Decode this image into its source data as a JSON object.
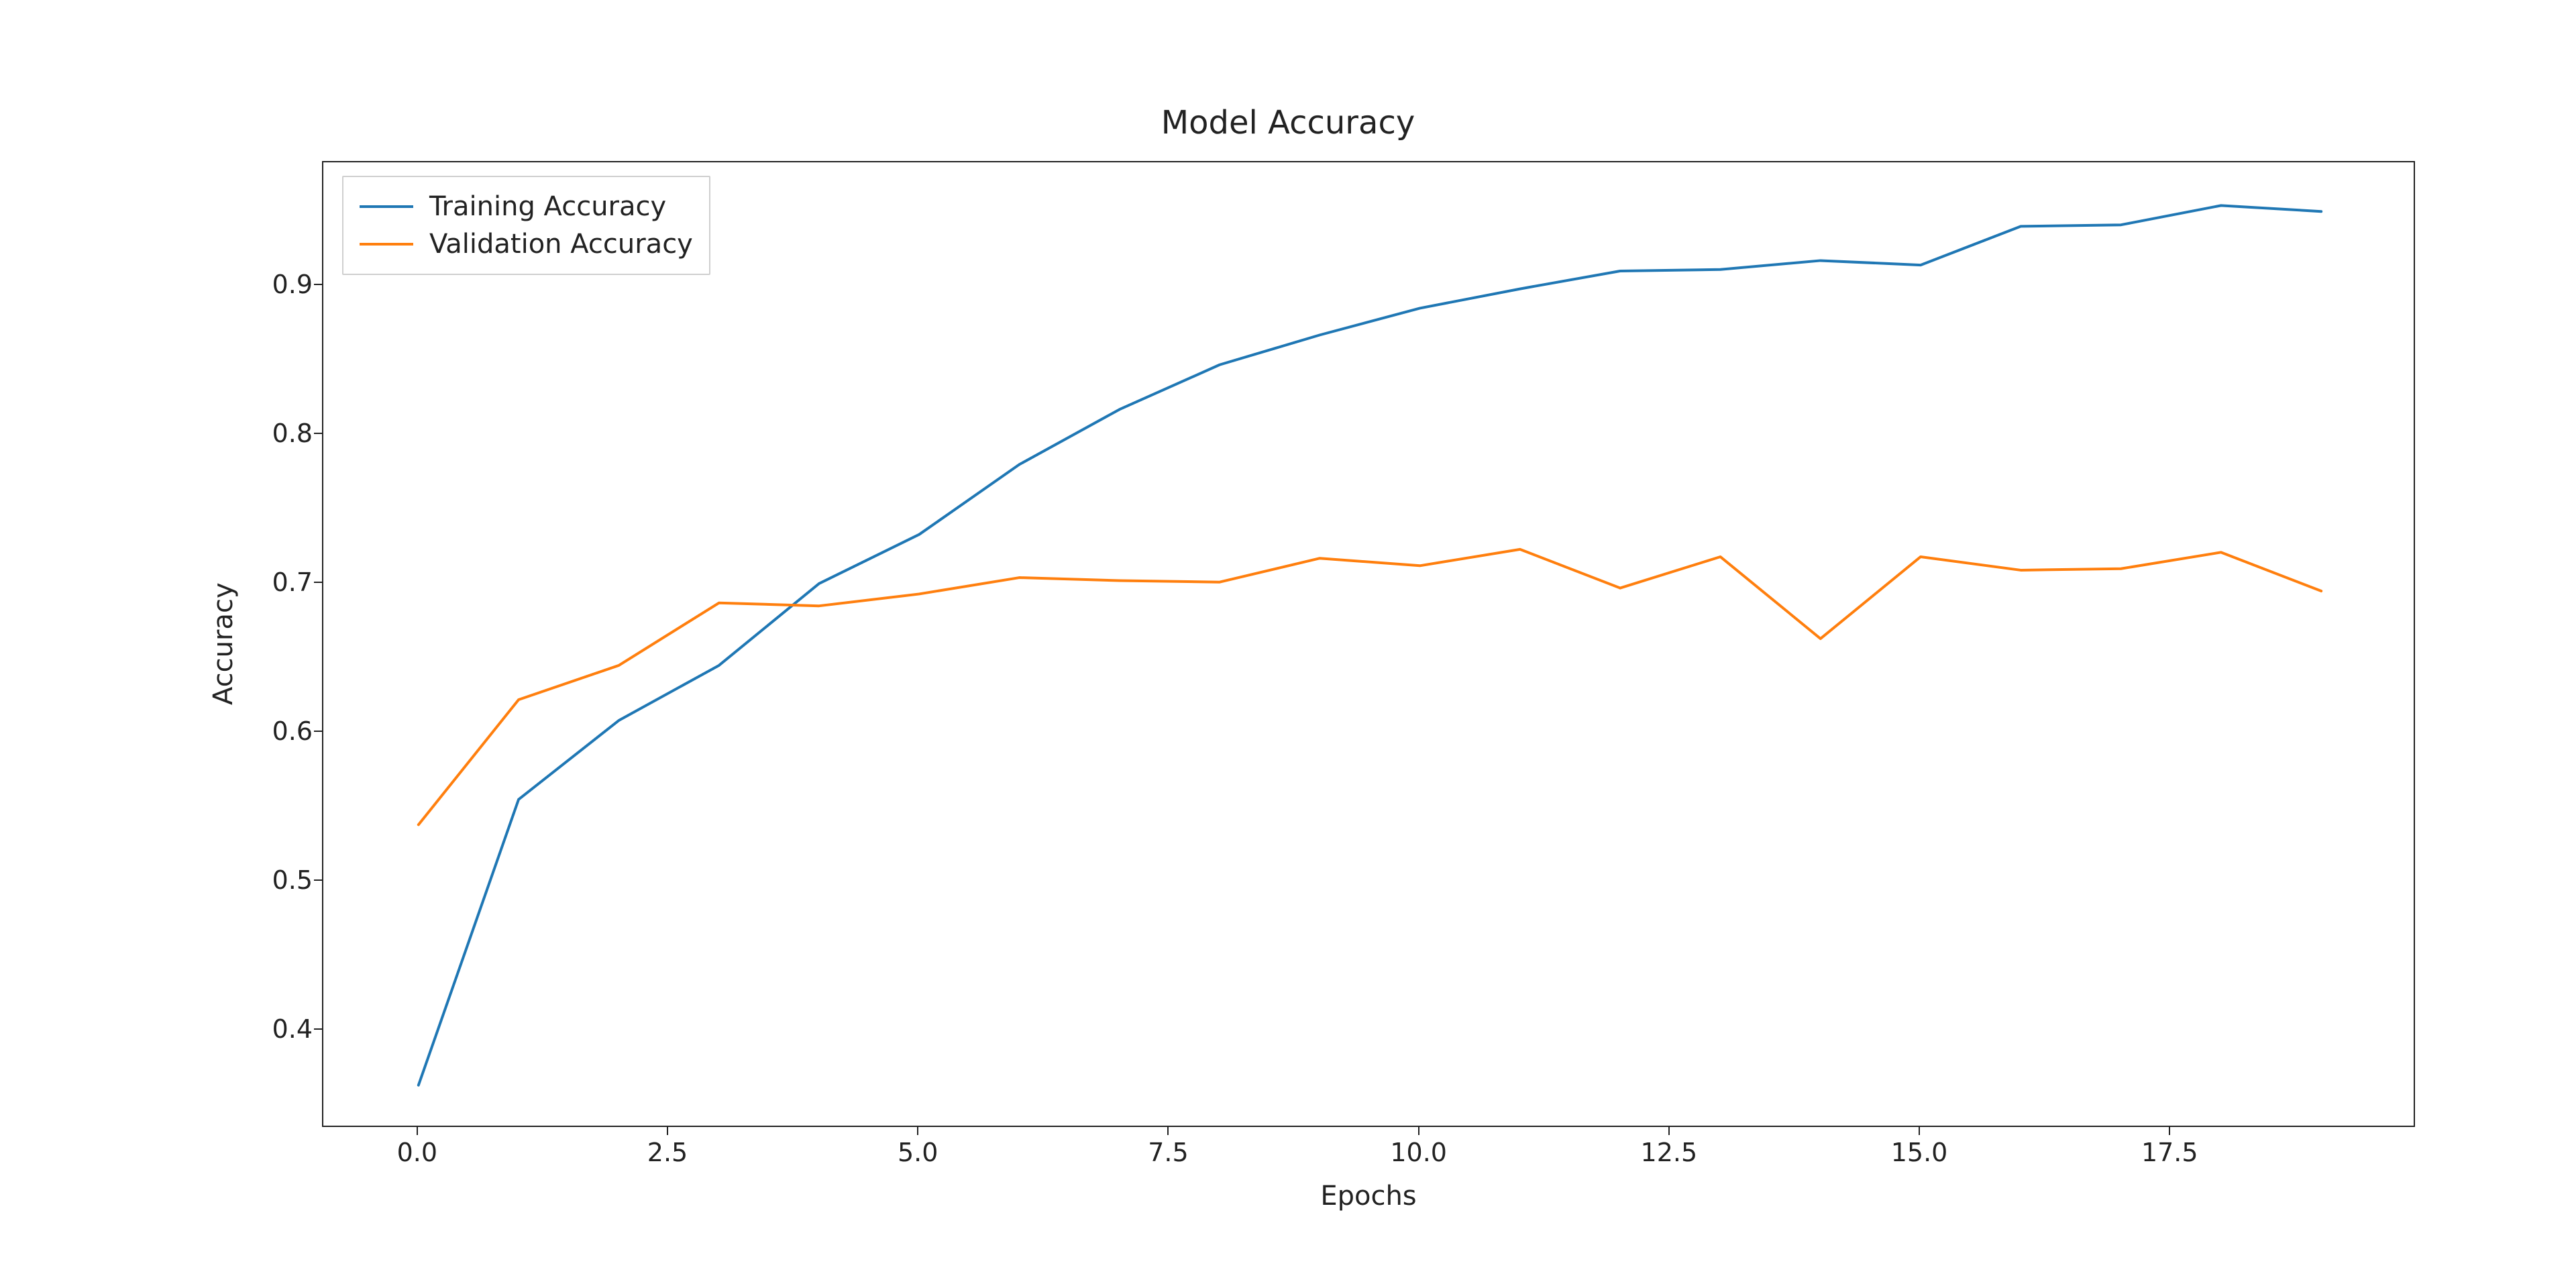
{
  "chart_data": {
    "type": "line",
    "title": "Model Accuracy",
    "xlabel": "Epochs",
    "ylabel": "Accuracy",
    "xlim": [
      -0.95,
      19.95
    ],
    "ylim": [
      0.334,
      0.983
    ],
    "xticks": [
      0.0,
      2.5,
      5.0,
      7.5,
      10.0,
      12.5,
      15.0,
      17.5
    ],
    "yticks": [
      0.4,
      0.5,
      0.6,
      0.7,
      0.8,
      0.9
    ],
    "x": [
      0,
      1,
      2,
      3,
      4,
      5,
      6,
      7,
      8,
      9,
      10,
      11,
      12,
      13,
      14,
      15,
      16,
      17,
      18,
      19
    ],
    "series": [
      {
        "name": "Training Accuracy",
        "color": "#1f77b4",
        "values": [
          0.363,
          0.555,
          0.608,
          0.645,
          0.7,
          0.733,
          0.78,
          0.817,
          0.847,
          0.867,
          0.885,
          0.898,
          0.91,
          0.911,
          0.917,
          0.914,
          0.94,
          0.941,
          0.954,
          0.95
        ]
      },
      {
        "name": "Validation Accuracy",
        "color": "#ff7f0e",
        "values": [
          0.538,
          0.622,
          0.645,
          0.687,
          0.685,
          0.693,
          0.704,
          0.702,
          0.701,
          0.717,
          0.712,
          0.723,
          0.697,
          0.718,
          0.663,
          0.718,
          0.709,
          0.71,
          0.721,
          0.695
        ]
      }
    ]
  },
  "legend": {
    "items": [
      {
        "label": "Training Accuracy"
      },
      {
        "label": "Validation Accuracy"
      }
    ]
  }
}
